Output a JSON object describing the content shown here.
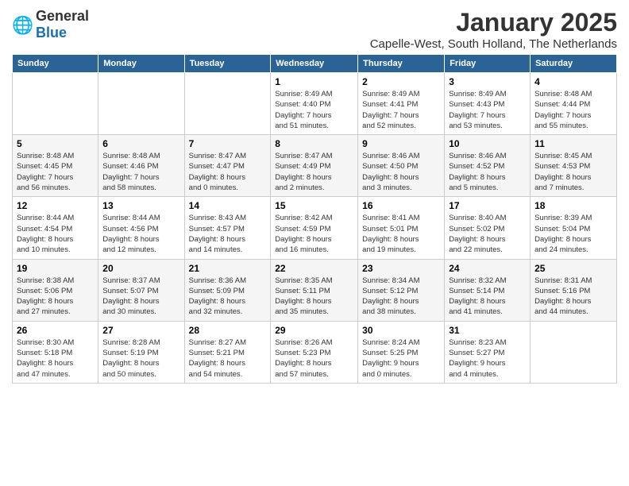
{
  "logo": {
    "general": "General",
    "blue": "Blue"
  },
  "title": "January 2025",
  "location": "Capelle-West, South Holland, The Netherlands",
  "days_of_week": [
    "Sunday",
    "Monday",
    "Tuesday",
    "Wednesday",
    "Thursday",
    "Friday",
    "Saturday"
  ],
  "weeks": [
    [
      {
        "day": "",
        "info": ""
      },
      {
        "day": "",
        "info": ""
      },
      {
        "day": "",
        "info": ""
      },
      {
        "day": "1",
        "info": "Sunrise: 8:49 AM\nSunset: 4:40 PM\nDaylight: 7 hours\nand 51 minutes."
      },
      {
        "day": "2",
        "info": "Sunrise: 8:49 AM\nSunset: 4:41 PM\nDaylight: 7 hours\nand 52 minutes."
      },
      {
        "day": "3",
        "info": "Sunrise: 8:49 AM\nSunset: 4:43 PM\nDaylight: 7 hours\nand 53 minutes."
      },
      {
        "day": "4",
        "info": "Sunrise: 8:48 AM\nSunset: 4:44 PM\nDaylight: 7 hours\nand 55 minutes."
      }
    ],
    [
      {
        "day": "5",
        "info": "Sunrise: 8:48 AM\nSunset: 4:45 PM\nDaylight: 7 hours\nand 56 minutes."
      },
      {
        "day": "6",
        "info": "Sunrise: 8:48 AM\nSunset: 4:46 PM\nDaylight: 7 hours\nand 58 minutes."
      },
      {
        "day": "7",
        "info": "Sunrise: 8:47 AM\nSunset: 4:47 PM\nDaylight: 8 hours\nand 0 minutes."
      },
      {
        "day": "8",
        "info": "Sunrise: 8:47 AM\nSunset: 4:49 PM\nDaylight: 8 hours\nand 2 minutes."
      },
      {
        "day": "9",
        "info": "Sunrise: 8:46 AM\nSunset: 4:50 PM\nDaylight: 8 hours\nand 3 minutes."
      },
      {
        "day": "10",
        "info": "Sunrise: 8:46 AM\nSunset: 4:52 PM\nDaylight: 8 hours\nand 5 minutes."
      },
      {
        "day": "11",
        "info": "Sunrise: 8:45 AM\nSunset: 4:53 PM\nDaylight: 8 hours\nand 7 minutes."
      }
    ],
    [
      {
        "day": "12",
        "info": "Sunrise: 8:44 AM\nSunset: 4:54 PM\nDaylight: 8 hours\nand 10 minutes."
      },
      {
        "day": "13",
        "info": "Sunrise: 8:44 AM\nSunset: 4:56 PM\nDaylight: 8 hours\nand 12 minutes."
      },
      {
        "day": "14",
        "info": "Sunrise: 8:43 AM\nSunset: 4:57 PM\nDaylight: 8 hours\nand 14 minutes."
      },
      {
        "day": "15",
        "info": "Sunrise: 8:42 AM\nSunset: 4:59 PM\nDaylight: 8 hours\nand 16 minutes."
      },
      {
        "day": "16",
        "info": "Sunrise: 8:41 AM\nSunset: 5:01 PM\nDaylight: 8 hours\nand 19 minutes."
      },
      {
        "day": "17",
        "info": "Sunrise: 8:40 AM\nSunset: 5:02 PM\nDaylight: 8 hours\nand 22 minutes."
      },
      {
        "day": "18",
        "info": "Sunrise: 8:39 AM\nSunset: 5:04 PM\nDaylight: 8 hours\nand 24 minutes."
      }
    ],
    [
      {
        "day": "19",
        "info": "Sunrise: 8:38 AM\nSunset: 5:06 PM\nDaylight: 8 hours\nand 27 minutes."
      },
      {
        "day": "20",
        "info": "Sunrise: 8:37 AM\nSunset: 5:07 PM\nDaylight: 8 hours\nand 30 minutes."
      },
      {
        "day": "21",
        "info": "Sunrise: 8:36 AM\nSunset: 5:09 PM\nDaylight: 8 hours\nand 32 minutes."
      },
      {
        "day": "22",
        "info": "Sunrise: 8:35 AM\nSunset: 5:11 PM\nDaylight: 8 hours\nand 35 minutes."
      },
      {
        "day": "23",
        "info": "Sunrise: 8:34 AM\nSunset: 5:12 PM\nDaylight: 8 hours\nand 38 minutes."
      },
      {
        "day": "24",
        "info": "Sunrise: 8:32 AM\nSunset: 5:14 PM\nDaylight: 8 hours\nand 41 minutes."
      },
      {
        "day": "25",
        "info": "Sunrise: 8:31 AM\nSunset: 5:16 PM\nDaylight: 8 hours\nand 44 minutes."
      }
    ],
    [
      {
        "day": "26",
        "info": "Sunrise: 8:30 AM\nSunset: 5:18 PM\nDaylight: 8 hours\nand 47 minutes."
      },
      {
        "day": "27",
        "info": "Sunrise: 8:28 AM\nSunset: 5:19 PM\nDaylight: 8 hours\nand 50 minutes."
      },
      {
        "day": "28",
        "info": "Sunrise: 8:27 AM\nSunset: 5:21 PM\nDaylight: 8 hours\nand 54 minutes."
      },
      {
        "day": "29",
        "info": "Sunrise: 8:26 AM\nSunset: 5:23 PM\nDaylight: 8 hours\nand 57 minutes."
      },
      {
        "day": "30",
        "info": "Sunrise: 8:24 AM\nSunset: 5:25 PM\nDaylight: 9 hours\nand 0 minutes."
      },
      {
        "day": "31",
        "info": "Sunrise: 8:23 AM\nSunset: 5:27 PM\nDaylight: 9 hours\nand 4 minutes."
      },
      {
        "day": "",
        "info": ""
      }
    ]
  ]
}
